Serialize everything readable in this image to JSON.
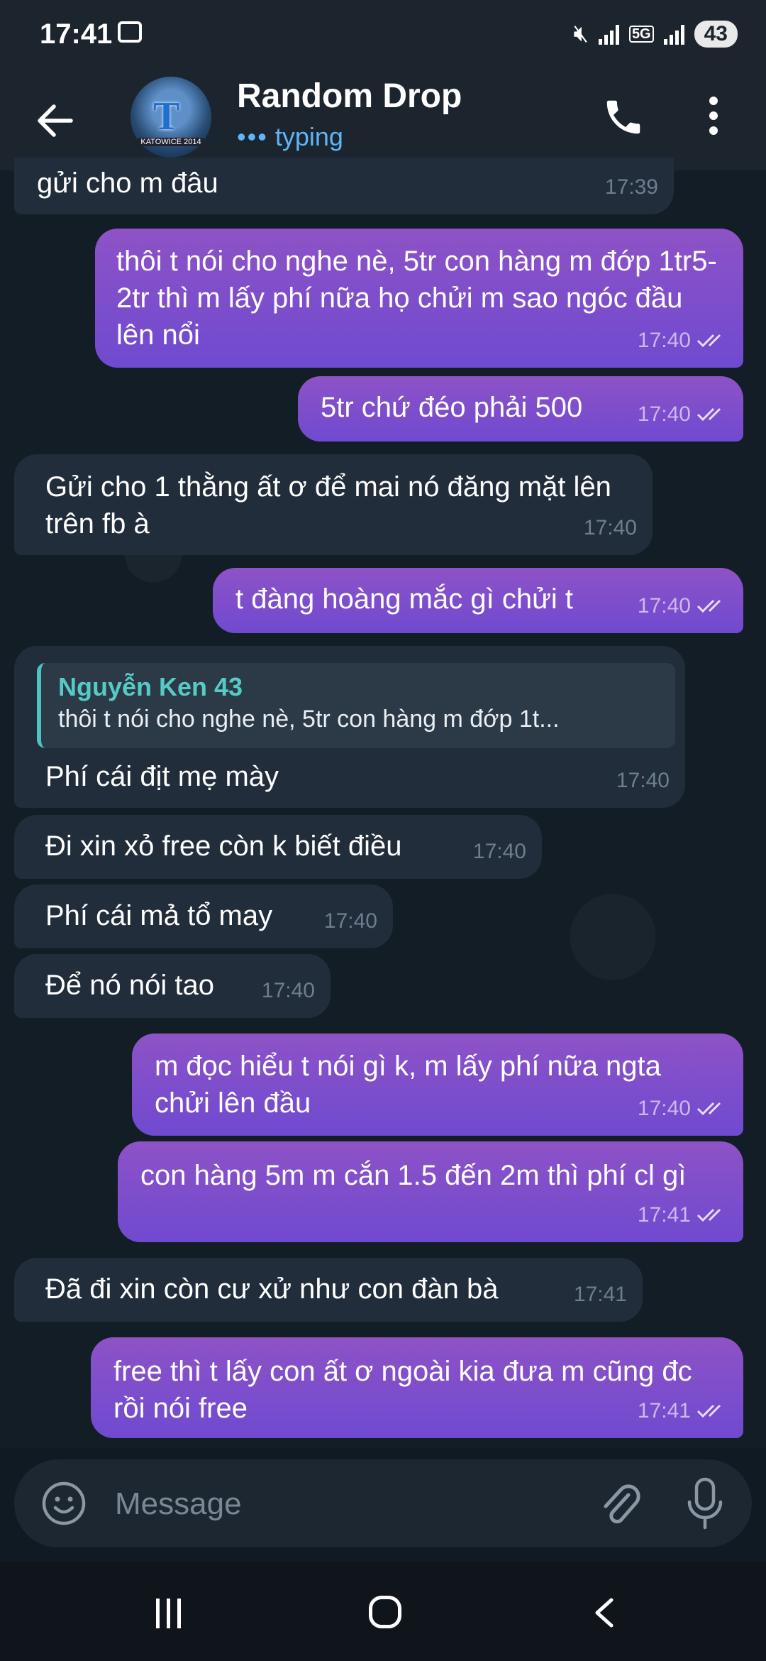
{
  "status_bar": {
    "time": "17:41",
    "net": "5G",
    "battery": "43"
  },
  "header": {
    "title": "Random Drop",
    "status_dots": "•••",
    "status": "typing",
    "avatar_caption": "KATOWICE 2014"
  },
  "messages": [
    {
      "side": "in",
      "text": "gửi cho m đâu",
      "time": "17:39"
    },
    {
      "side": "out",
      "text": "thôi t nói cho nghe nè, 5tr con hàng m đớp 1tr5-2tr thì m lấy phí nữa họ chửi m sao ngóc đầu lên nổi",
      "time": "17:40"
    },
    {
      "side": "out",
      "text": "5tr chứ đéo phải 500",
      "time": "17:40"
    },
    {
      "side": "in",
      "text": "Gửi cho 1 thằng ất ơ để mai nó đăng mặt lên trên fb à",
      "time": "17:40"
    },
    {
      "side": "out",
      "text": "t đàng hoàng mắc gì chửi t",
      "time": "17:40"
    },
    {
      "side": "in",
      "reply_name": "Nguyễn Ken 43",
      "reply_text": "thôi t nói cho nghe nè, 5tr con hàng m đớp 1t...",
      "text": "Phí cái địt mẹ mày",
      "time": "17:40"
    },
    {
      "side": "in",
      "text": "Đi xin xỏ free còn k biết điều",
      "time": "17:40"
    },
    {
      "side": "in",
      "text": "Phí cái mả tổ may",
      "time": "17:40"
    },
    {
      "side": "in",
      "text": "Để nó nói tao",
      "time": "17:40"
    },
    {
      "side": "out",
      "text": "m đọc hiểu t nói gì k, m lấy phí nữa ngta chửi lên đầu",
      "time": "17:40"
    },
    {
      "side": "out",
      "text": "con hàng 5m m cắn 1.5 đến 2m thì phí cl gì",
      "time": "17:41"
    },
    {
      "side": "in",
      "text": "Đã đi xin còn cư xử như con đàn bà",
      "time": "17:41"
    },
    {
      "side": "out",
      "text": "free thì t lấy con ất ơ ngoài kia đưa m cũng đc rồi nói free",
      "time": "17:41"
    }
  ],
  "input": {
    "placeholder": "Message"
  },
  "colors": {
    "incoming": "#212d3b",
    "outgoing_top": "#8e52c6",
    "outgoing_bottom": "#6f4ad0",
    "accent": "#5eb5f7",
    "reply_name": "#56cbc6"
  }
}
